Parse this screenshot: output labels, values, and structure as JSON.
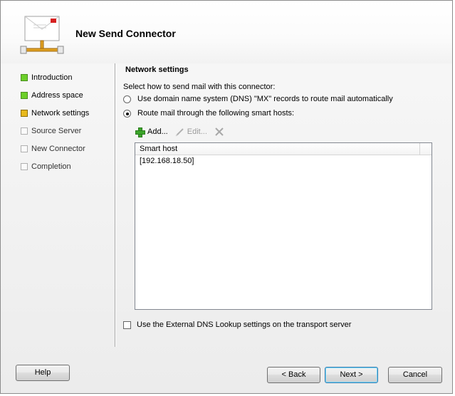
{
  "wizard": {
    "title": "New Send Connector",
    "icon": "mail-envelope-network-icon"
  },
  "nav": {
    "items": [
      {
        "label": "Introduction",
        "state": "done"
      },
      {
        "label": "Address space",
        "state": "done"
      },
      {
        "label": "Network settings",
        "state": "current"
      },
      {
        "label": "Source Server",
        "state": "pending"
      },
      {
        "label": "New Connector",
        "state": "pending"
      },
      {
        "label": "Completion",
        "state": "pending"
      }
    ]
  },
  "main": {
    "section_title": "Network settings",
    "prompt": "Select how to send mail with this connector:",
    "radio_dns": {
      "label": "Use domain name system (DNS) \"MX\" records to route mail automatically",
      "checked": false
    },
    "radio_smarthost": {
      "label": "Route mail through the following smart hosts:",
      "checked": true
    },
    "toolbar": {
      "add_label": "Add...",
      "edit_label": "Edit...",
      "remove_icon": "delete-x-icon"
    },
    "list": {
      "column_header": "Smart host",
      "rows": [
        "[192.168.18.50]"
      ]
    },
    "external_dns_checkbox": {
      "label": "Use the External DNS Lookup settings on the transport server",
      "checked": false
    }
  },
  "footer": {
    "help_label": "Help",
    "back_label": "< Back",
    "next_label": "Next >",
    "cancel_label": "Cancel"
  },
  "colors": {
    "done": "#6ccf29",
    "current": "#e8b91c",
    "pending": "#fafafa"
  }
}
